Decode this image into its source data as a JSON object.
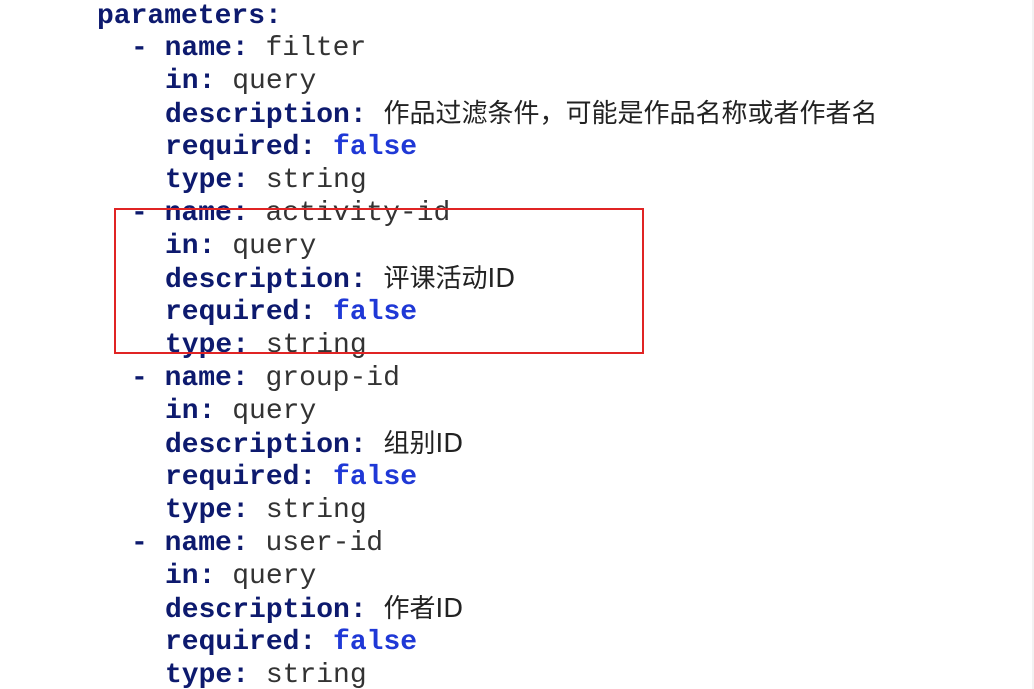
{
  "yaml": {
    "root_key": "parameters",
    "params": [
      {
        "name": "filter",
        "in": "query",
        "description": "作品过滤条件，可能是作品名称或者作者名",
        "required": "false",
        "type": "string"
      },
      {
        "name": "activity-id",
        "in": "query",
        "description": "评课活动ID",
        "required": "false",
        "type": "string"
      },
      {
        "name": "group-id",
        "in": "query",
        "description": "组别ID",
        "required": "false",
        "type": "string"
      },
      {
        "name": "user-id",
        "in": "query",
        "description": "作者ID",
        "required": "false",
        "type": "string"
      }
    ],
    "labels": {
      "name": "name",
      "in": "in",
      "description": "description",
      "required": "required",
      "type": "type",
      "colon": ":",
      "dash": "-"
    }
  },
  "colors": {
    "key": "#0d1a6e",
    "boolean": "#1f38d6",
    "string": "#333333",
    "highlight_border": "#e02424"
  }
}
